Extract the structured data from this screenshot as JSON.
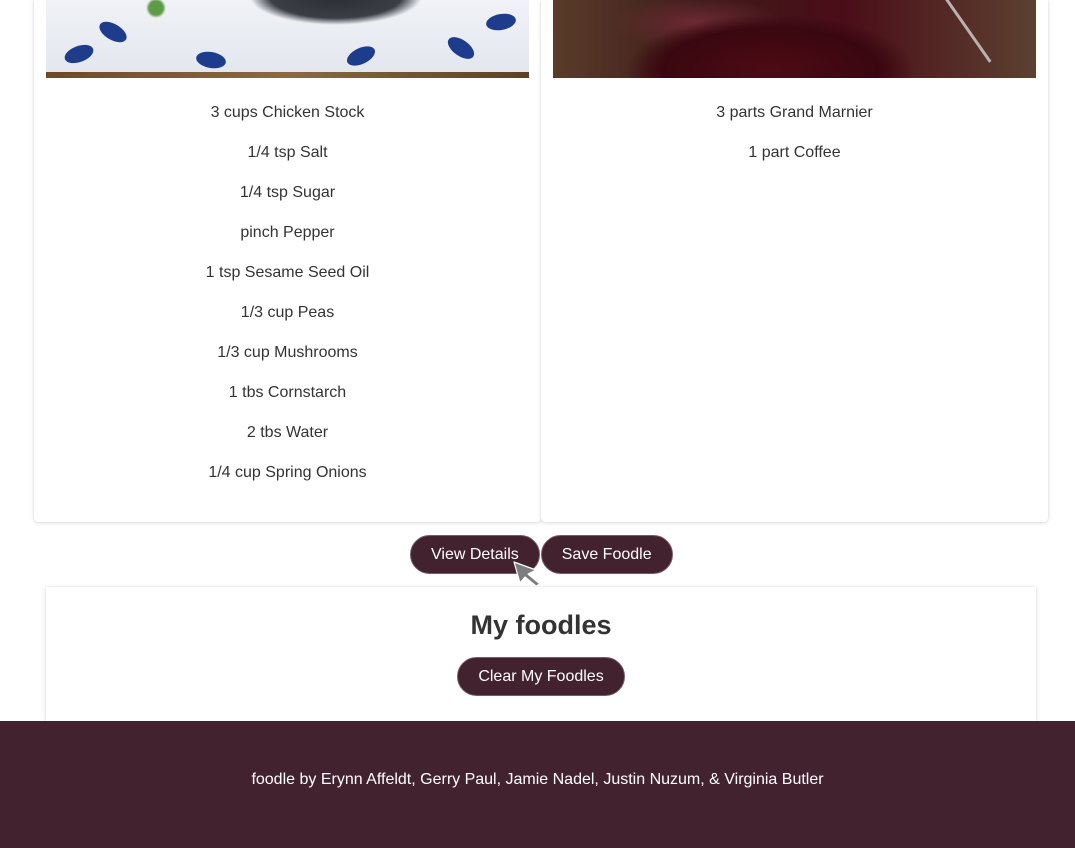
{
  "cards": [
    {
      "image_alt": "dish-photo",
      "ingredients": [
        "3 cups Chicken Stock",
        "1/4 tsp Salt",
        "1/4 tsp Sugar",
        "pinch Pepper",
        "1 tsp Sesame Seed Oil",
        "1/3 cup Peas",
        "1/3 cup Mushrooms",
        "1 tbs Cornstarch",
        "2 tbs Water",
        "1/4 cup Spring Onions"
      ]
    },
    {
      "image_alt": "drink-photo",
      "ingredients": [
        "3 parts Grand Marnier",
        "1 part Coffee"
      ]
    }
  ],
  "actions": {
    "view_details_label": "View Details",
    "save_foodle_label": "Save Foodle"
  },
  "my_foodles": {
    "heading": "My foodles",
    "clear_label": "Clear My Foodles"
  },
  "footer": {
    "credits": "foodle by Erynn Affeldt, Gerry Paul, Jamie Nadel, Justin Nuzum, & Virginia Butler"
  },
  "colors": {
    "brand": "#43222f",
    "text": "#333333",
    "background": "#ffffff"
  },
  "icons": {
    "cursor": "mouse-pointer-icon"
  }
}
